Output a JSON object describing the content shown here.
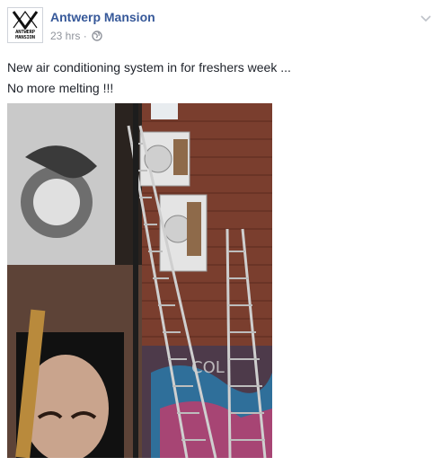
{
  "post": {
    "page_name": "Antwerp Mansion",
    "timestamp": "23 hrs",
    "separator": "·",
    "privacy_icon": "globe-icon",
    "text_lines": [
      "New air conditioning system in for freshers week ...",
      "No more melting !!!"
    ],
    "avatar_logo_text": [
      "ANTWERP",
      "MANSION"
    ]
  },
  "icons": {
    "menu": "chevron-down-icon",
    "avatar": "antwerp-mansion-logo"
  },
  "colors": {
    "link_blue": "#365899",
    "meta_grey": "#90949c",
    "text": "#1d2129"
  }
}
